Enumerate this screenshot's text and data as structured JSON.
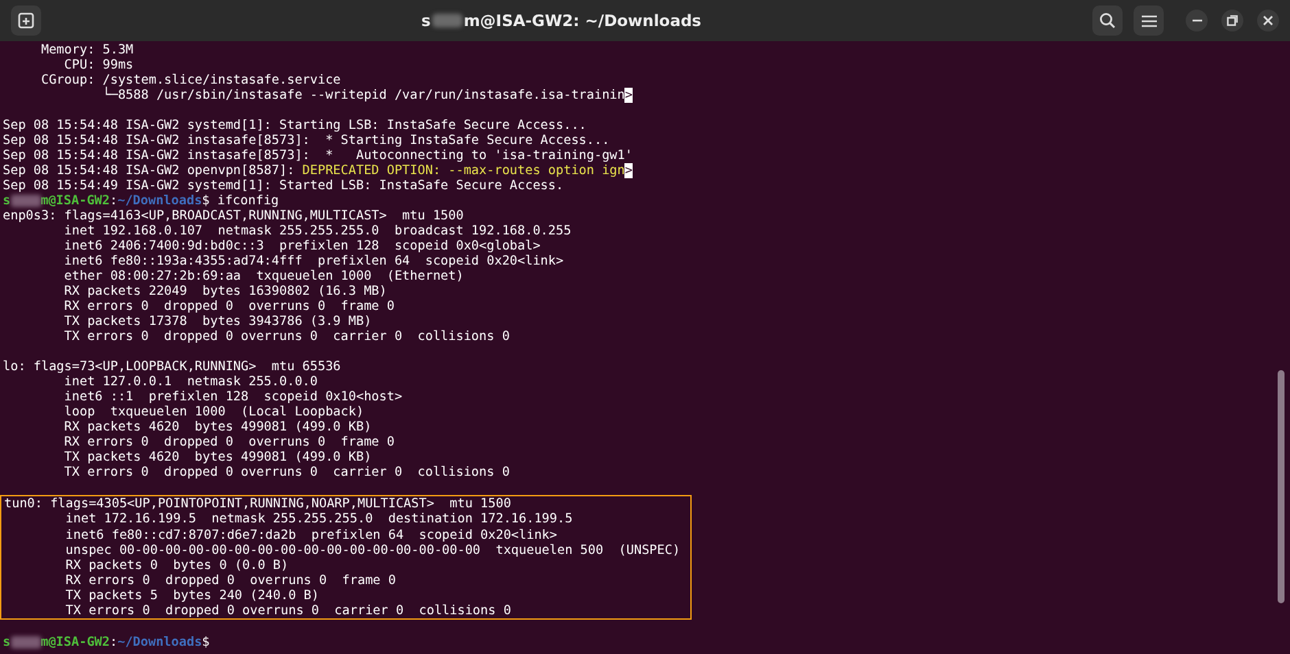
{
  "window": {
    "title": [
      {
        "kind": "text",
        "text": "s"
      },
      {
        "kind": "redacted"
      },
      {
        "kind": "text",
        "text": "m@ISA-GW2: ~/Downloads"
      }
    ]
  },
  "terminal": {
    "blocks": [
      {
        "highlighted": false,
        "lines": [
          {
            "segments": [
              {
                "kind": "text",
                "text": "     Memory: 5.3M"
              }
            ]
          },
          {
            "segments": [
              {
                "kind": "text",
                "text": "        CPU: 99ms"
              }
            ]
          },
          {
            "segments": [
              {
                "kind": "text",
                "text": "     CGroup: /system.slice/instasafe.service"
              }
            ]
          },
          {
            "segments": [
              {
                "kind": "text",
                "text": "             └─8588 /usr/sbin/instasafe --writepid /var/run/instasafe.isa-trainin"
              },
              {
                "kind": "overflow",
                "text": ">"
              }
            ]
          },
          {
            "kind": "blank"
          },
          {
            "segments": [
              {
                "kind": "text",
                "text": "Sep 08 15:54:48 ISA-GW2 systemd[1]: Starting LSB: InstaSafe Secure Access..."
              }
            ]
          },
          {
            "segments": [
              {
                "kind": "text",
                "text": "Sep 08 15:54:48 ISA-GW2 instasafe[8573]:  * Starting InstaSafe Secure Access..."
              }
            ]
          },
          {
            "segments": [
              {
                "kind": "text",
                "text": "Sep 08 15:54:48 ISA-GW2 instasafe[8573]:  *   Autoconnecting to 'isa-training-gw1'"
              }
            ]
          },
          {
            "segments": [
              {
                "kind": "text",
                "text": "Sep 08 15:54:48 ISA-GW2 openvpn[8587]: "
              },
              {
                "kind": "warning",
                "text": "DEPRECATED OPTION: --max-routes option ign"
              },
              {
                "kind": "overflow",
                "text": ">"
              }
            ]
          },
          {
            "segments": [
              {
                "kind": "text",
                "text": "Sep 08 15:54:49 ISA-GW2 systemd[1]: Started LSB: InstaSafe Secure Access."
              }
            ]
          },
          {
            "segments": [
              {
                "kind": "user",
                "text": "s"
              },
              {
                "kind": "redacted"
              },
              {
                "kind": "user",
                "text": "m@ISA-GW2"
              },
              {
                "kind": "text",
                "text": ":"
              },
              {
                "kind": "path",
                "text": "~/Downloads"
              },
              {
                "kind": "text",
                "text": "$ ifconfig"
              }
            ]
          },
          {
            "segments": [
              {
                "kind": "text",
                "text": "enp0s3: flags=4163<UP,BROADCAST,RUNNING,MULTICAST>  mtu 1500"
              }
            ]
          },
          {
            "segments": [
              {
                "kind": "text",
                "text": "        inet 192.168.0.107  netmask 255.255.255.0  broadcast 192.168.0.255"
              }
            ]
          },
          {
            "segments": [
              {
                "kind": "text",
                "text": "        inet6 2406:7400:9d:bd0c::3  prefixlen 128  scopeid 0x0<global>"
              }
            ]
          },
          {
            "segments": [
              {
                "kind": "text",
                "text": "        inet6 fe80::193a:4355:ad74:4fff  prefixlen 64  scopeid 0x20<link>"
              }
            ]
          },
          {
            "segments": [
              {
                "kind": "text",
                "text": "        ether 08:00:27:2b:69:aa  txqueuelen 1000  (Ethernet)"
              }
            ]
          },
          {
            "segments": [
              {
                "kind": "text",
                "text": "        RX packets 22049  bytes 16390802 (16.3 MB)"
              }
            ]
          },
          {
            "segments": [
              {
                "kind": "text",
                "text": "        RX errors 0  dropped 0  overruns 0  frame 0"
              }
            ]
          },
          {
            "segments": [
              {
                "kind": "text",
                "text": "        TX packets 17378  bytes 3943786 (3.9 MB)"
              }
            ]
          },
          {
            "segments": [
              {
                "kind": "text",
                "text": "        TX errors 0  dropped 0 overruns 0  carrier 0  collisions 0"
              }
            ]
          },
          {
            "kind": "blank"
          },
          {
            "segments": [
              {
                "kind": "text",
                "text": "lo: flags=73<UP,LOOPBACK,RUNNING>  mtu 65536"
              }
            ]
          },
          {
            "segments": [
              {
                "kind": "text",
                "text": "        inet 127.0.0.1  netmask 255.0.0.0"
              }
            ]
          },
          {
            "segments": [
              {
                "kind": "text",
                "text": "        inet6 ::1  prefixlen 128  scopeid 0x10<host>"
              }
            ]
          },
          {
            "segments": [
              {
                "kind": "text",
                "text": "        loop  txqueuelen 1000  (Local Loopback)"
              }
            ]
          },
          {
            "segments": [
              {
                "kind": "text",
                "text": "        RX packets 4620  bytes 499081 (499.0 KB)"
              }
            ]
          },
          {
            "segments": [
              {
                "kind": "text",
                "text": "        RX errors 0  dropped 0  overruns 0  frame 0"
              }
            ]
          },
          {
            "segments": [
              {
                "kind": "text",
                "text": "        TX packets 4620  bytes 499081 (499.0 KB)"
              }
            ]
          },
          {
            "segments": [
              {
                "kind": "text",
                "text": "        TX errors 0  dropped 0 overruns 0  carrier 0  collisions 0"
              }
            ]
          },
          {
            "kind": "blank"
          }
        ]
      },
      {
        "highlighted": true,
        "lines": [
          {
            "segments": [
              {
                "kind": "text",
                "text": "tun0: flags=4305<UP,POINTOPOINT,RUNNING,NOARP,MULTICAST>  mtu 1500"
              }
            ]
          },
          {
            "segments": [
              {
                "kind": "text",
                "text": "        inet 172.16.199.5  netmask 255.255.255.0  destination 172.16.199.5"
              }
            ]
          },
          {
            "segments": [
              {
                "kind": "text",
                "text": "        inet6 fe80::cd7:8707:d6e7:da2b  prefixlen 64  scopeid 0x20<link>"
              }
            ]
          },
          {
            "segments": [
              {
                "kind": "text",
                "text": "        unspec 00-00-00-00-00-00-00-00-00-00-00-00-00-00-00-00  txqueuelen 500  (UNSPEC)"
              }
            ]
          },
          {
            "segments": [
              {
                "kind": "text",
                "text": "        RX packets 0  bytes 0 (0.0 B)"
              }
            ]
          },
          {
            "segments": [
              {
                "kind": "text",
                "text": "        RX errors 0  dropped 0  overruns 0  frame 0"
              }
            ]
          },
          {
            "segments": [
              {
                "kind": "text",
                "text": "        TX packets 5  bytes 240 (240.0 B)"
              }
            ]
          },
          {
            "segments": [
              {
                "kind": "text",
                "text": "        TX errors 0  dropped 0 overruns 0  carrier 0  collisions 0"
              }
            ]
          }
        ]
      },
      {
        "highlighted": false,
        "lines": [
          {
            "kind": "blank"
          },
          {
            "segments": [
              {
                "kind": "user",
                "text": "s"
              },
              {
                "kind": "redacted"
              },
              {
                "kind": "user",
                "text": "m@ISA-GW2"
              },
              {
                "kind": "text",
                "text": ":"
              },
              {
                "kind": "path",
                "text": "~/Downloads"
              },
              {
                "kind": "text",
                "text": "$"
              }
            ]
          }
        ]
      }
    ]
  }
}
